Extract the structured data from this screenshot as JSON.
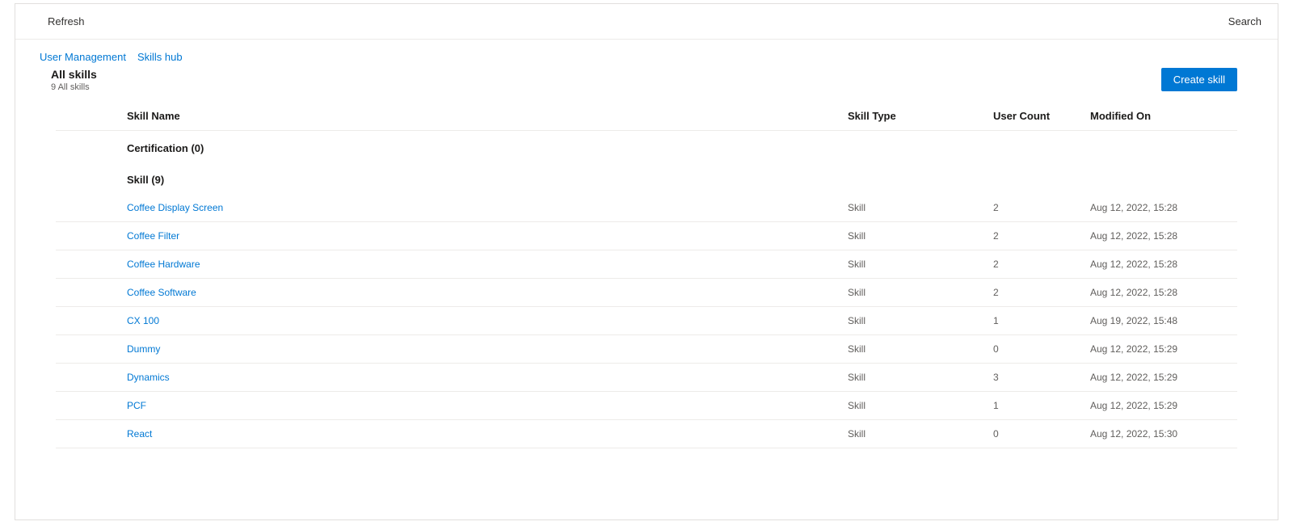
{
  "commandBar": {
    "refresh": "Refresh",
    "search": "Search"
  },
  "breadcrumb": {
    "item1": "User Management",
    "item2": "Skills hub"
  },
  "header": {
    "title": "All skills",
    "subtitle": "9 All skills",
    "createButton": "Create skill"
  },
  "columns": {
    "skillName": "Skill Name",
    "skillType": "Skill Type",
    "userCount": "User Count",
    "modifiedOn": "Modified On"
  },
  "groups": [
    {
      "label": "Certification (0)",
      "rows": []
    },
    {
      "label": "Skill (9)",
      "rows": [
        {
          "name": "Coffee Display Screen",
          "type": "Skill",
          "count": "2",
          "modified": "Aug 12, 2022, 15:28"
        },
        {
          "name": "Coffee Filter",
          "type": "Skill",
          "count": "2",
          "modified": "Aug 12, 2022, 15:28"
        },
        {
          "name": "Coffee Hardware",
          "type": "Skill",
          "count": "2",
          "modified": "Aug 12, 2022, 15:28"
        },
        {
          "name": "Coffee Software",
          "type": "Skill",
          "count": "2",
          "modified": "Aug 12, 2022, 15:28"
        },
        {
          "name": "CX 100",
          "type": "Skill",
          "count": "1",
          "modified": "Aug 19, 2022, 15:48"
        },
        {
          "name": "Dummy",
          "type": "Skill",
          "count": "0",
          "modified": "Aug 12, 2022, 15:29"
        },
        {
          "name": "Dynamics",
          "type": "Skill",
          "count": "3",
          "modified": "Aug 12, 2022, 15:29"
        },
        {
          "name": "PCF",
          "type": "Skill",
          "count": "1",
          "modified": "Aug 12, 2022, 15:29"
        },
        {
          "name": "React",
          "type": "Skill",
          "count": "0",
          "modified": "Aug 12, 2022, 15:30"
        }
      ]
    }
  ]
}
